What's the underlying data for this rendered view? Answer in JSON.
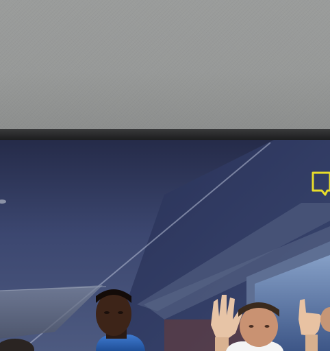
{
  "scene": {
    "subject": "tv-screen-on-wall"
  },
  "colors": {
    "wall": "#979998",
    "bezel": "#222325",
    "screen_sky_top": "#2b3150",
    "screen_sky_mid": "#46527a",
    "screen_panel": "#596789",
    "accent_yellow": "#e8dd2a",
    "jersey_blue": "#2f68b8",
    "doorway_blue": "#6f8bb5"
  },
  "icons": {
    "badge": "speech-bubble-icon"
  }
}
